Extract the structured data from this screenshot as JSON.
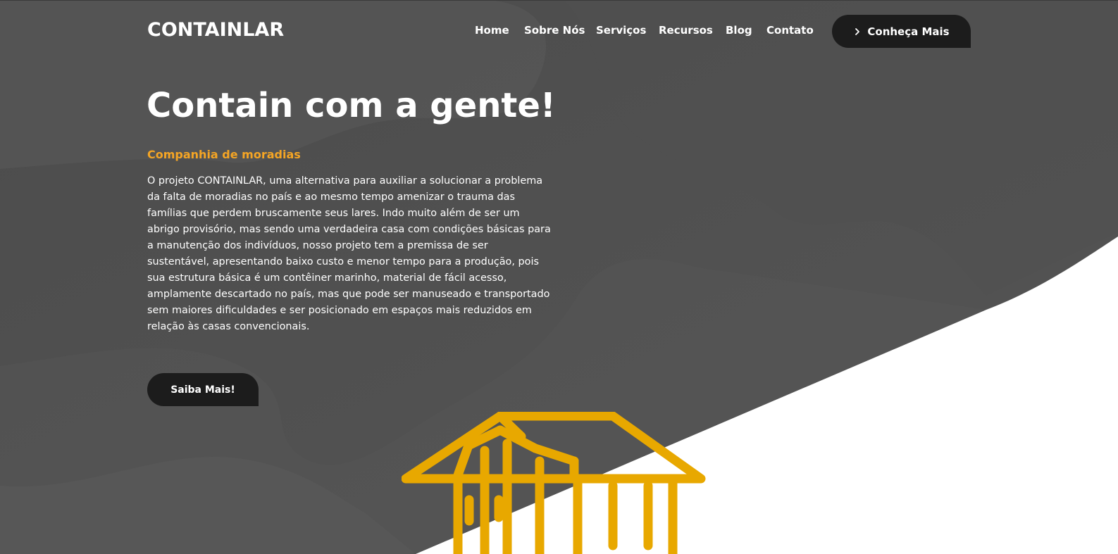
{
  "header": {
    "logo": "CONTAINLAR",
    "nav": {
      "home": "Home",
      "sobre": "Sobre Nós",
      "servicos": "Serviços",
      "recursos": "Recursos",
      "blog": "Blog",
      "contato": "Contato"
    },
    "cta_label": "Conheça Mais",
    "cta_icon": "chevron-right-icon"
  },
  "hero": {
    "title": "Contain com a gente!",
    "subtitle": "Companhia de moradias",
    "body": "O projeto CONTAINLAR, uma alternativa para auxiliar a solucionar a problema da falta de moradias no país e ao mesmo tempo amenizar o trauma das famílias que perdem bruscamente seus lares. Indo muito além de ser um abrigo provisório, mas sendo uma verdadeira casa com condições básicas para a manutenção dos indivíduos, nosso projeto tem a premissa de ser sustentável, apresentando baixo custo e menor tempo para a produção, pois sua estrutura básica é um contêiner marinho, material de fácil acesso, amplamente descartado no país, mas que pode ser manuseado e transportado sem maiores dificuldades e ser posicionado em espaços mais reduzidos em relação às casas convencionais.",
    "button_label": "Saiba Mais!",
    "illustration": "house-container-icon"
  },
  "colors": {
    "hero_background": "#4f4f4f",
    "accent": "#f5a524",
    "button_dark": "#1c1c1c",
    "illustration": "#e8a800",
    "page_background": "#ffffff"
  }
}
